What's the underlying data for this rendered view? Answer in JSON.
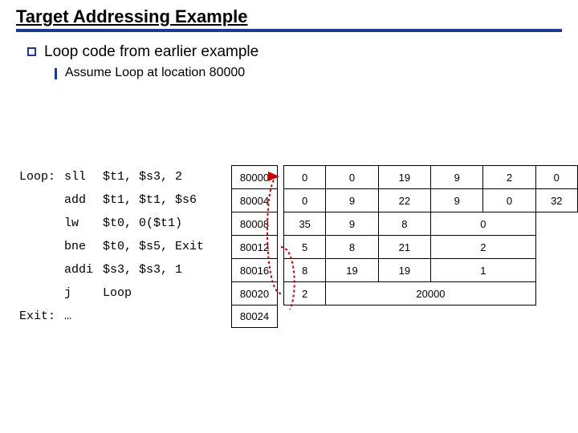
{
  "title": "Target Addressing Example",
  "bullet1": "Loop code from earlier example",
  "bullet2": "Assume Loop at location 80000",
  "code": {
    "rows": [
      {
        "label": "Loop:",
        "mnem": "sll",
        "ops": "$t1, $s3, 2",
        "addr": "80000"
      },
      {
        "label": "",
        "mnem": "add",
        "ops": "$t1, $t1, $s6",
        "addr": "80004"
      },
      {
        "label": "",
        "mnem": "lw",
        "ops": "$t0, 0($t1)",
        "addr": "80008"
      },
      {
        "label": "",
        "mnem": "bne",
        "ops": "$t0, $s5, Exit",
        "addr": "80012"
      },
      {
        "label": "",
        "mnem": "addi",
        "ops": "$s3, $s3, 1",
        "addr": "80016"
      },
      {
        "label": "",
        "mnem": "j",
        "ops": "Loop",
        "addr": "80020"
      },
      {
        "label": "Exit:",
        "mnem": "…",
        "ops": "",
        "addr": "80024"
      }
    ]
  },
  "enc": {
    "r0": [
      "0",
      "0",
      "19",
      "9",
      "2",
      "0"
    ],
    "r1": [
      "0",
      "9",
      "22",
      "9",
      "0",
      "32"
    ],
    "r2": [
      "35",
      "9",
      "8",
      "0"
    ],
    "r3": [
      "5",
      "8",
      "21",
      "2"
    ],
    "r4": [
      "8",
      "19",
      "19",
      "1"
    ],
    "r5": [
      "2",
      "20000"
    ]
  },
  "chart_data": {
    "type": "table",
    "title": "MIPS instruction encoding at base address 80000",
    "rows": [
      {
        "addr": 80000,
        "asm": "sll $t1, $s3, 2",
        "fields": [
          0,
          0,
          19,
          9,
          2,
          0
        ]
      },
      {
        "addr": 80004,
        "asm": "add $t1, $t1, $s6",
        "fields": [
          0,
          9,
          22,
          9,
          0,
          32
        ]
      },
      {
        "addr": 80008,
        "asm": "lw $t0, 0($t1)",
        "fields": [
          35,
          9,
          8,
          0
        ]
      },
      {
        "addr": 80012,
        "asm": "bne $t0, $s5, Exit",
        "fields": [
          5,
          8,
          21,
          2
        ]
      },
      {
        "addr": 80016,
        "asm": "addi $s3, $s3, 1",
        "fields": [
          8,
          19,
          19,
          1
        ]
      },
      {
        "addr": 80020,
        "asm": "j Loop",
        "fields": [
          2,
          20000
        ]
      },
      {
        "addr": 80024,
        "asm": "Exit: …",
        "fields": []
      }
    ]
  }
}
